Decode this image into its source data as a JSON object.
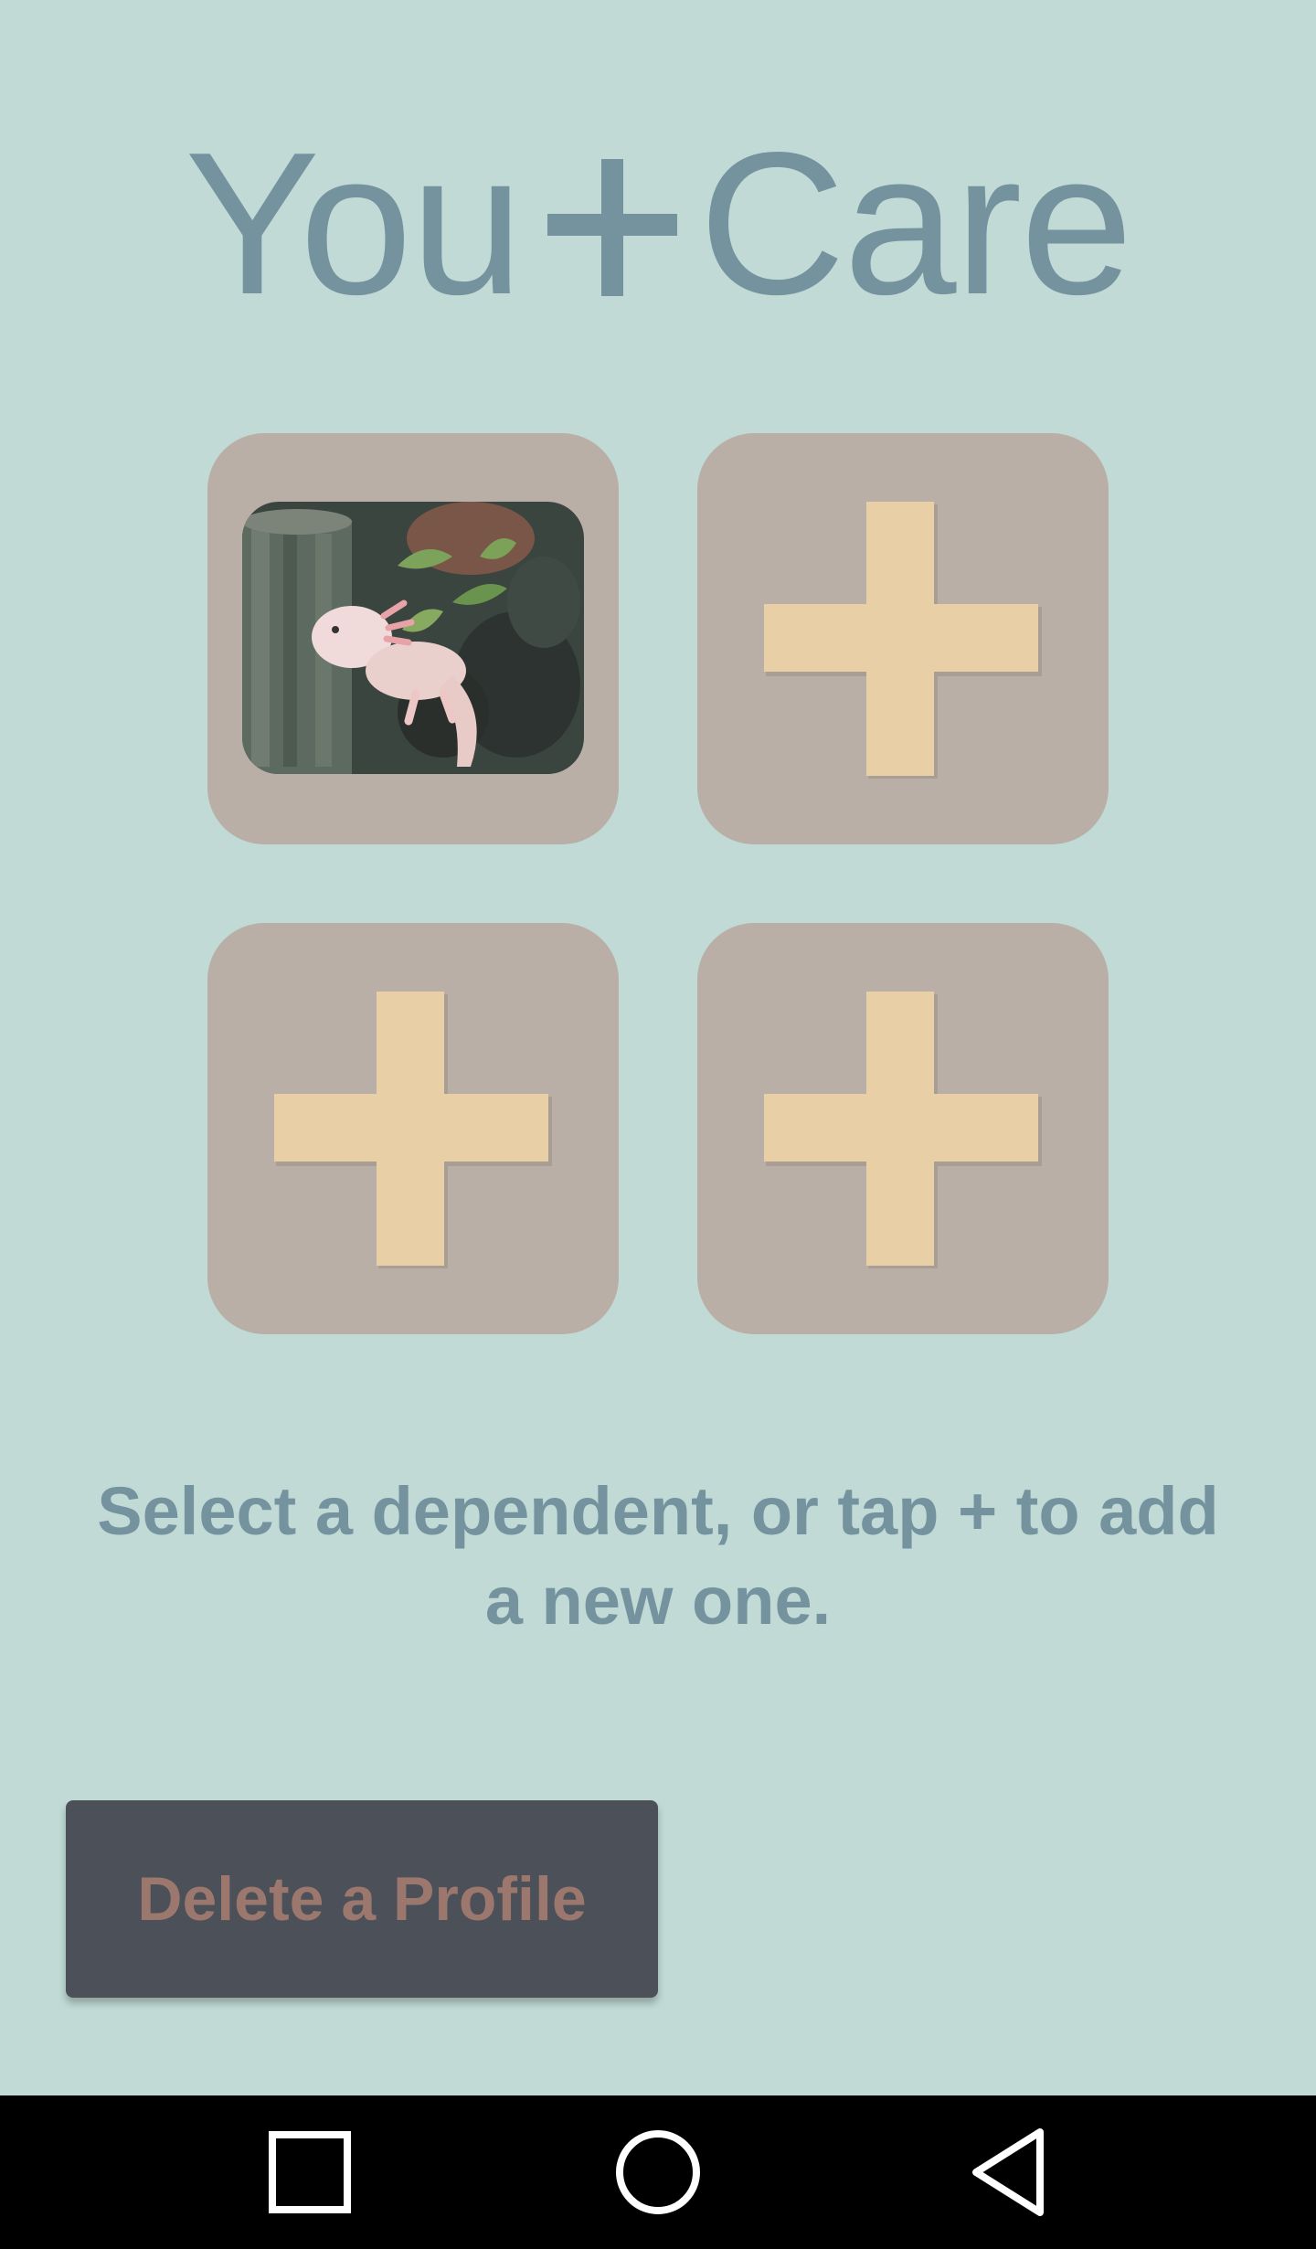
{
  "app": {
    "title_left": "You",
    "title_right": "Care",
    "title_icon": "plus-icon"
  },
  "profiles": [
    {
      "type": "photo",
      "description_icon": "axolotl-photo"
    },
    {
      "type": "add",
      "icon": "plus-icon"
    },
    {
      "type": "add",
      "icon": "plus-icon"
    },
    {
      "type": "add",
      "icon": "plus-icon"
    }
  ],
  "instruction": "Select a dependent, or tap + to add a new one.",
  "delete_button": {
    "label": "Delete a Profile"
  },
  "navbar": {
    "recents_icon": "square-icon",
    "home_icon": "circle-icon",
    "back_icon": "triangle-back-icon"
  },
  "colors": {
    "background": "#c1dad6",
    "title": "#75939f",
    "tile": "#b9afa6",
    "plus": "#e9cfa5",
    "button_bg": "#4b5059",
    "button_text": "#9c776d"
  }
}
